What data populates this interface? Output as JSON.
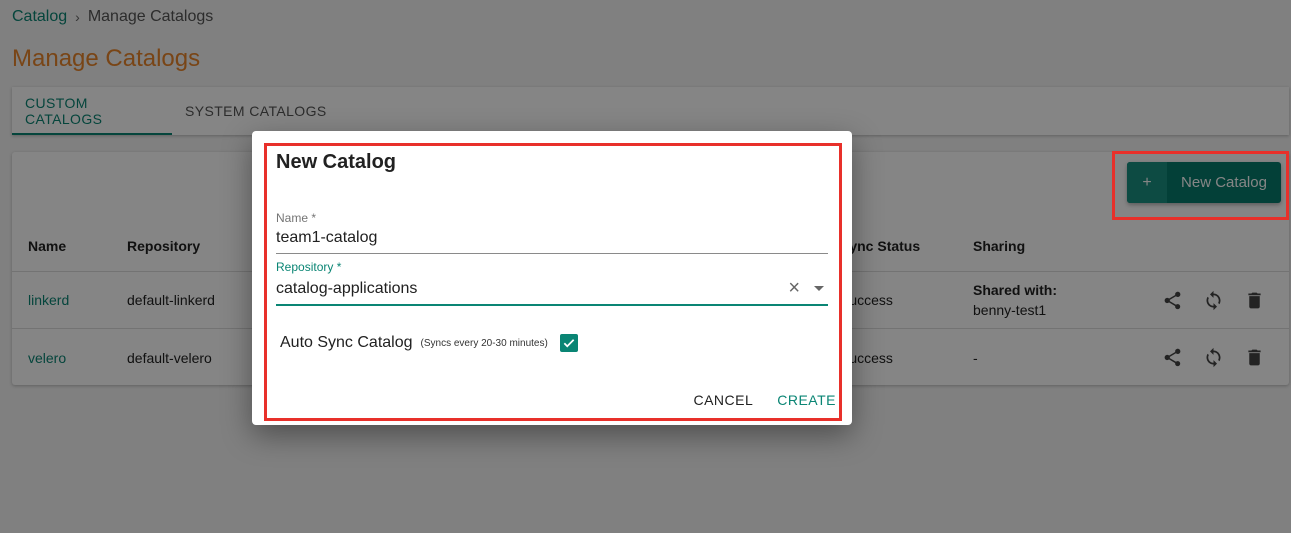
{
  "breadcrumb": {
    "parent": "Catalog",
    "separator": "›",
    "current": "Manage Catalogs"
  },
  "page_title": "Manage Catalogs",
  "tabs": [
    {
      "label": "CUSTOM CATALOGS",
      "active": true
    },
    {
      "label": "SYSTEM CATALOGS",
      "active": false
    }
  ],
  "new_catalog_button": {
    "icon": "plus-icon",
    "plus": "+",
    "label": "New Catalog"
  },
  "table": {
    "headers": {
      "name": "Name",
      "repository": "Repository",
      "sync_status": "Sync Status",
      "sharing": "Sharing"
    },
    "rows": [
      {
        "name": "linkerd",
        "repository": "default-linkerd",
        "sync_status": "Success",
        "sharing_title": "Shared with:",
        "sharing_value": "benny-test1"
      },
      {
        "name": "velero",
        "repository": "default-velero",
        "sync_status": "Success",
        "sharing_title": "",
        "sharing_value": "-"
      }
    ],
    "row_actions": [
      "share-icon",
      "sync-icon",
      "delete-icon"
    ]
  },
  "dialog": {
    "title": "New Catalog",
    "name_field": {
      "label": "Name *",
      "value": "team1-catalog"
    },
    "repository_field": {
      "label": "Repository *",
      "value": "catalog-applications",
      "clear_icon": "×"
    },
    "auto_sync": {
      "label": "Auto Sync Catalog",
      "hint": "(Syncs every 20-30 minutes)",
      "checked": true
    },
    "cancel_label": "CANCEL",
    "create_label": "CREATE"
  },
  "colors": {
    "accent": "#0a8574",
    "title": "#e8852b",
    "annotation": "#e8302a"
  }
}
